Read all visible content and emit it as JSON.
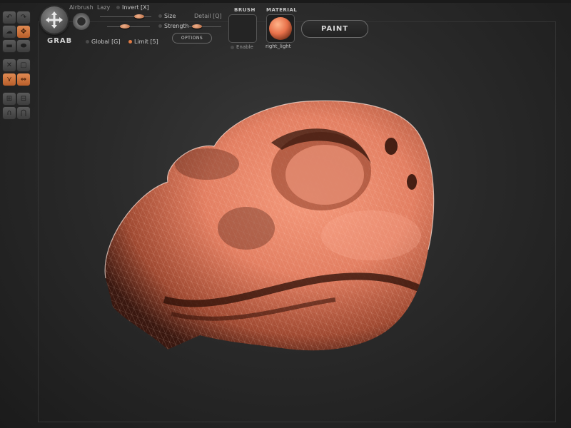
{
  "tool": {
    "name": "GRAB",
    "icon": "move-arrows-icon"
  },
  "options": {
    "airbrush": "Airbrush",
    "lazy": "Lazy",
    "invert": "Invert [X]",
    "size": "Size",
    "detail": "Detail [Q]",
    "strength": "Strength",
    "global": "Global [G]",
    "limit": "Limit [5]",
    "options_button": "OPTIONS"
  },
  "brush": {
    "label": "BRUSH",
    "enable": "Enable"
  },
  "material": {
    "label": "MATERIAL",
    "name": "right_light",
    "color": "#e8714a"
  },
  "paint_button": "PAINT",
  "toolbar_icons": [
    "undo-icon",
    "redo-icon",
    "cloud-icon",
    "move-icon",
    "smooth-icon",
    "flatten-icon",
    "mirror-x-icon",
    "grid-icon",
    "symmetry-icon",
    "swap-icon",
    "subdivide-icon",
    "decimate-icon",
    "mask-icon",
    "unmask-icon"
  ],
  "colors": {
    "accent": "#e07a44",
    "model": "#e37f62",
    "background": "#2a2a2a"
  }
}
